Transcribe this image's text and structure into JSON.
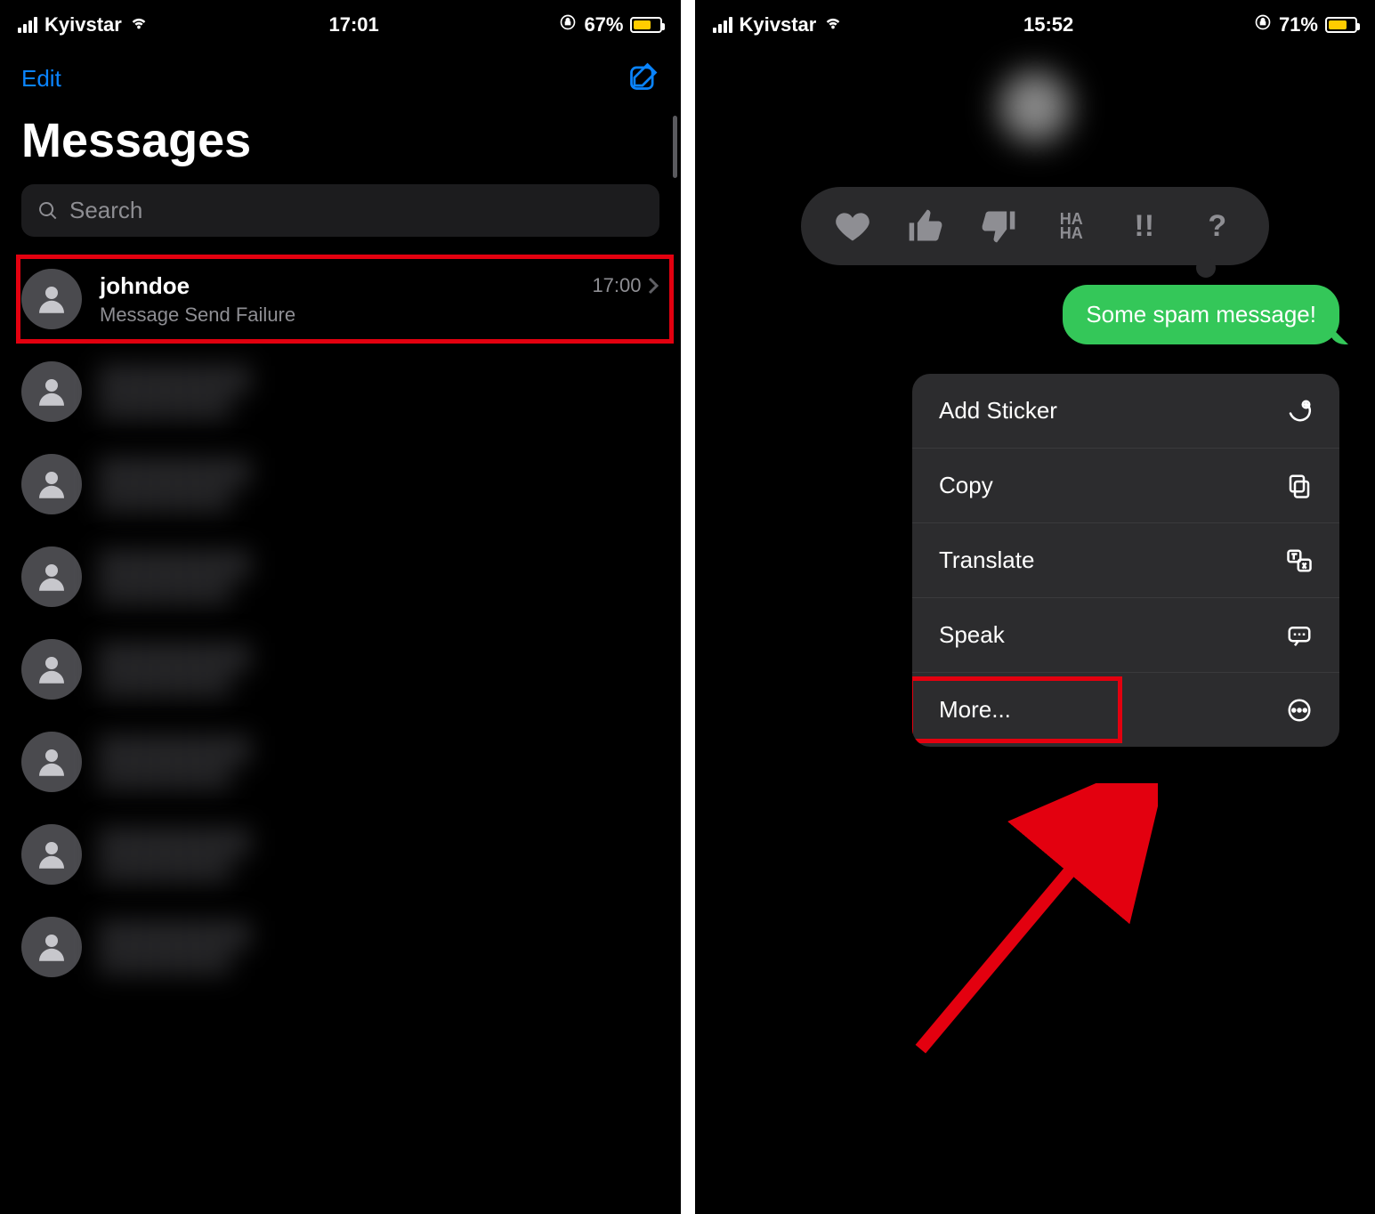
{
  "left": {
    "status": {
      "carrier": "Kyivstar",
      "time": "17:01",
      "battery_pct": "67%",
      "battery_fill": 67
    },
    "edit_label": "Edit",
    "title": "Messages",
    "search_placeholder": "Search",
    "highlighted": {
      "name": "johndoe",
      "time": "17:00",
      "preview": "Message Send Failure"
    }
  },
  "right": {
    "status": {
      "carrier": "Kyivstar",
      "time": "15:52",
      "battery_pct": "71%",
      "battery_fill": 71
    },
    "message_text": "Some spam message!",
    "tapbacks": {
      "haha": "HA HA",
      "exclaim": "!!",
      "question": "?"
    },
    "menu": {
      "addSticker": "Add Sticker",
      "copy": "Copy",
      "translate": "Translate",
      "speak": "Speak",
      "more": "More..."
    }
  }
}
